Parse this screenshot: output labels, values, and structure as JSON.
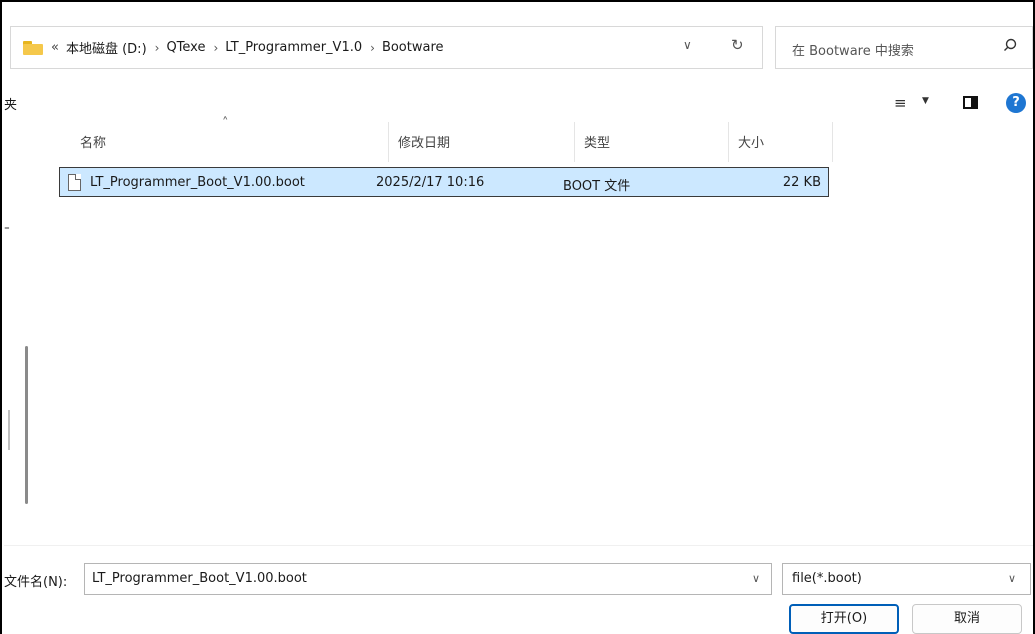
{
  "address": {
    "chevron": "«",
    "crumbs": [
      "本地磁盘 (D:)",
      "QTexe",
      "LT_Programmer_V1.0",
      "Bootware"
    ],
    "separator": "›"
  },
  "search": {
    "placeholder": "在 Bootware 中搜索"
  },
  "toolbar": {
    "partial_label": "夹"
  },
  "navpane": {
    "partial_glyph": "⁼"
  },
  "columns": {
    "name": "名称",
    "modified": "修改日期",
    "type": "类型",
    "size": "大小"
  },
  "files": [
    {
      "name": "LT_Programmer_Boot_V1.00.boot",
      "modified": "2025/2/17 10:16",
      "type": "BOOT 文件",
      "size": "22 KB"
    }
  ],
  "bottom": {
    "filename_label": "文件名(N):",
    "filename_value": "LT_Programmer_Boot_V1.00.boot",
    "filter_value": "file(*.boot)",
    "open_label": "打开(O)",
    "cancel_label": "取消"
  },
  "icons": {
    "folder": "folder-icon",
    "refresh": "refresh-icon",
    "search": "search-icon",
    "view": "view-menu-icon",
    "pane": "preview-pane-icon",
    "help": "help-icon",
    "file": "file-icon"
  },
  "colors": {
    "selection": "#cce8ff",
    "accent": "#005fb8",
    "help": "#1e76d2",
    "folder": "#f5c84b"
  }
}
